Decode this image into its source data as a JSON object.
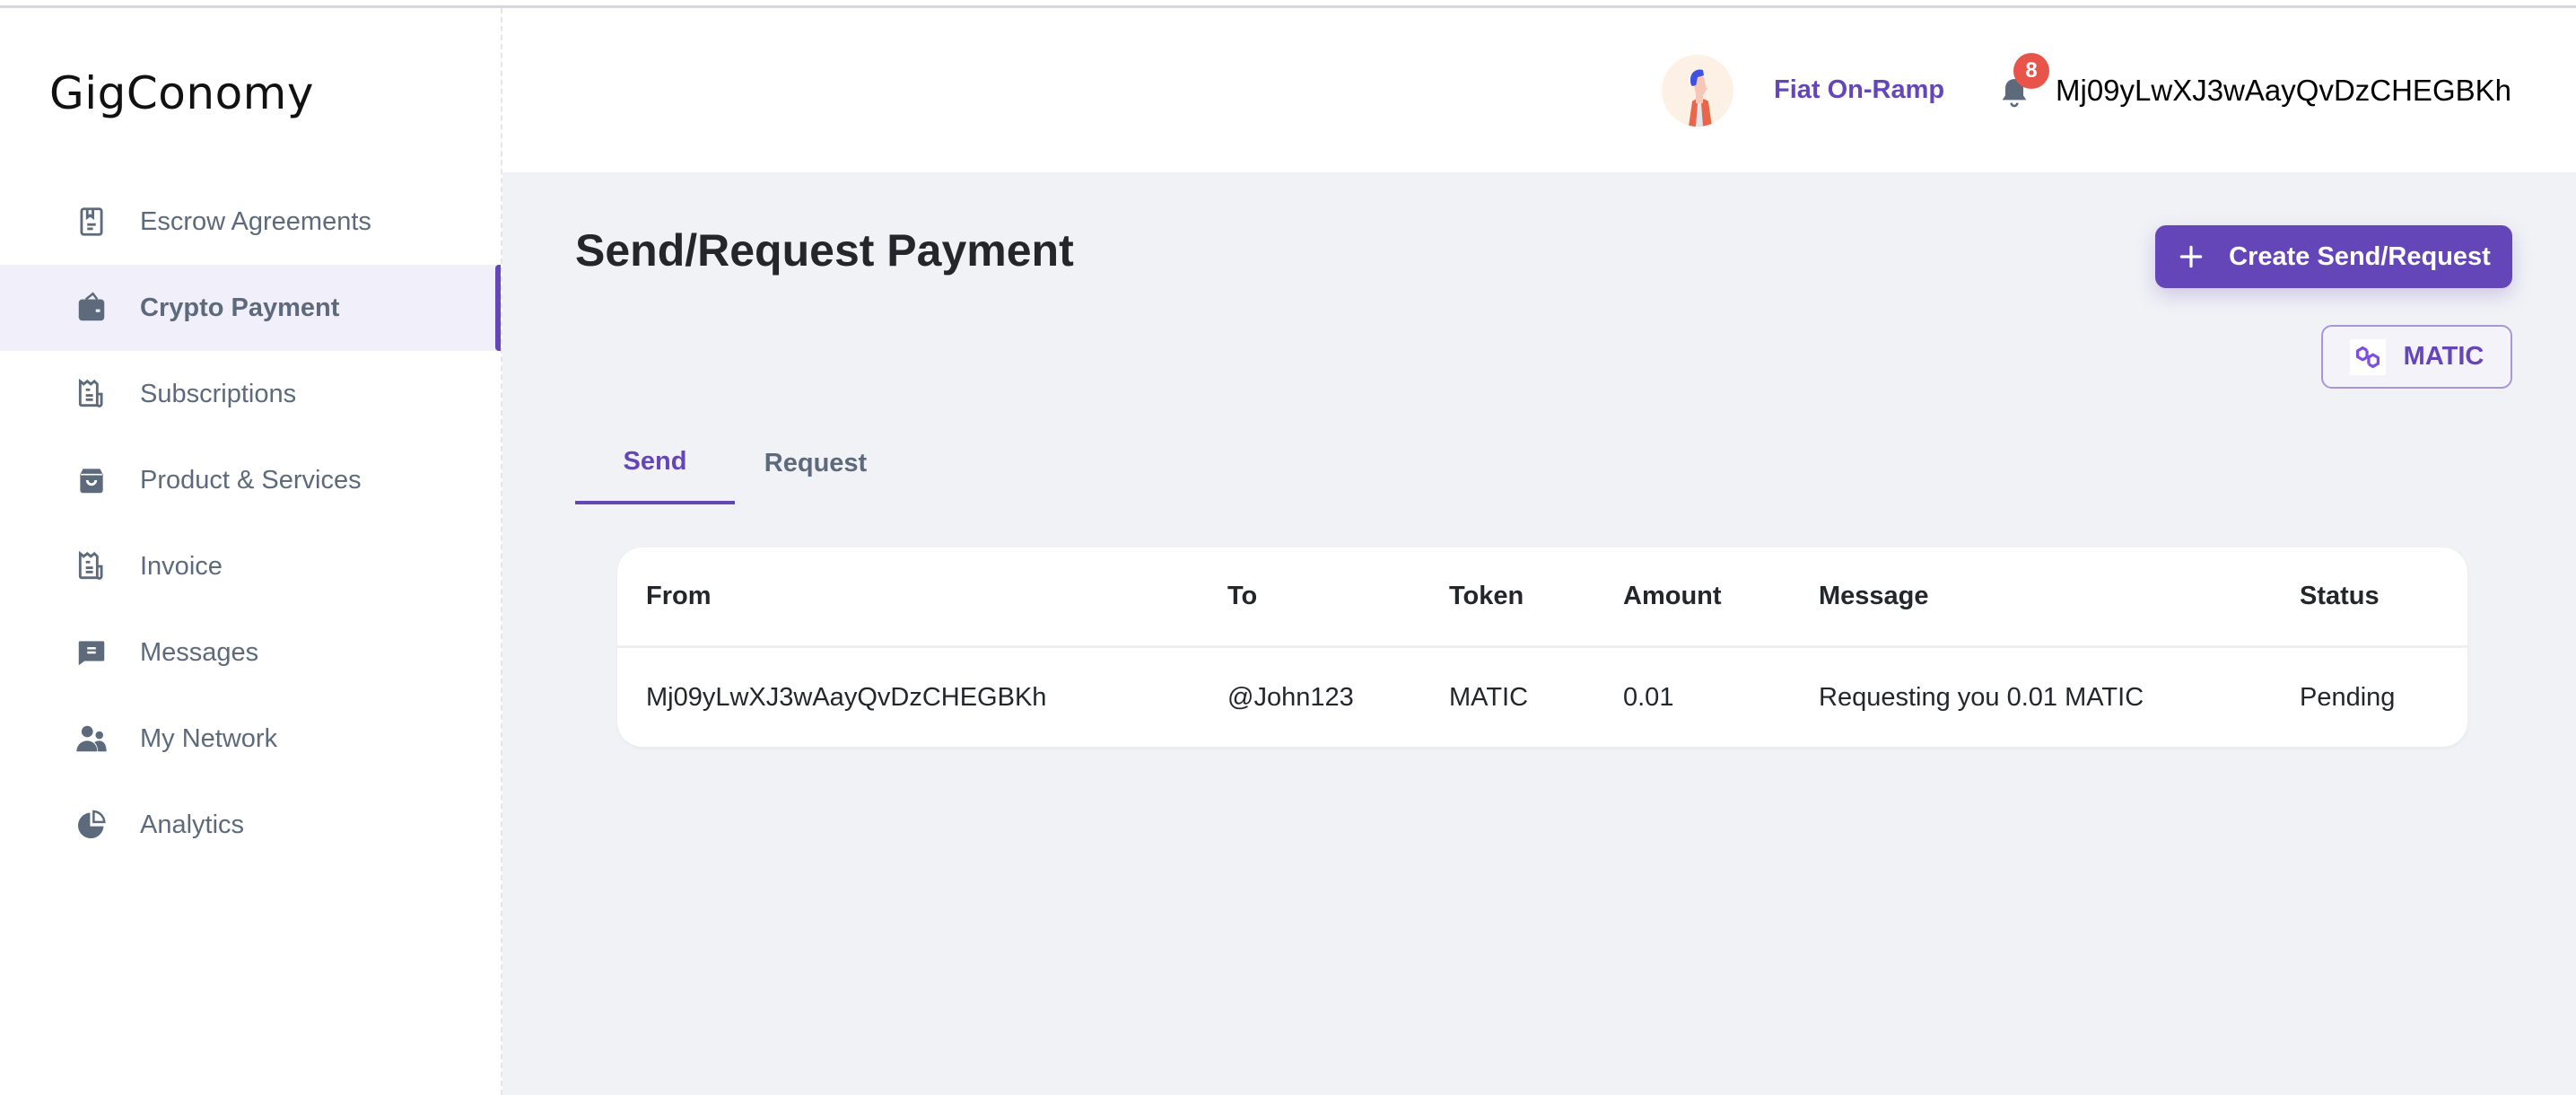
{
  "app": {
    "logo": "GigConomy"
  },
  "sidebar": {
    "items": [
      {
        "label": "Escrow Agreements",
        "icon": "bookmark-book-icon",
        "active": false
      },
      {
        "label": "Crypto Payment",
        "icon": "wallet-icon",
        "active": true
      },
      {
        "label": "Subscriptions",
        "icon": "receipt-icon",
        "active": false
      },
      {
        "label": "Product & Services",
        "icon": "shopping-bag-icon",
        "active": false
      },
      {
        "label": "Invoice",
        "icon": "receipt-icon",
        "active": false
      },
      {
        "label": "Messages",
        "icon": "message-icon",
        "active": false
      },
      {
        "label": "My Network",
        "icon": "people-icon",
        "active": false
      },
      {
        "label": "Analytics",
        "icon": "pie-chart-icon",
        "active": false
      }
    ]
  },
  "header": {
    "fiat_link": "Fiat On-Ramp",
    "notification_count": "8",
    "wallet_address": "Mj09yLwXJ3wAayQvDzCHEGBKh"
  },
  "main": {
    "title": "Send/Request Payment",
    "create_button": "Create Send/Request",
    "token_button": "MATIC",
    "tabs": [
      {
        "label": "Send",
        "active": true
      },
      {
        "label": "Request",
        "active": false
      }
    ],
    "table": {
      "columns": [
        "From",
        "To",
        "Token",
        "Amount",
        "Message",
        "Status"
      ],
      "rows": [
        [
          "Mj09yLwXJ3wAayQvDzCHEGBKh",
          "@John123",
          "MATIC",
          "0.01",
          "Requesting you 0.01 MATIC",
          "Pending"
        ]
      ]
    }
  },
  "colors": {
    "accent": "#6546b9",
    "badge": "#e8544a",
    "icon_gray": "#5d6a7c",
    "background": "#f1f2f6"
  }
}
